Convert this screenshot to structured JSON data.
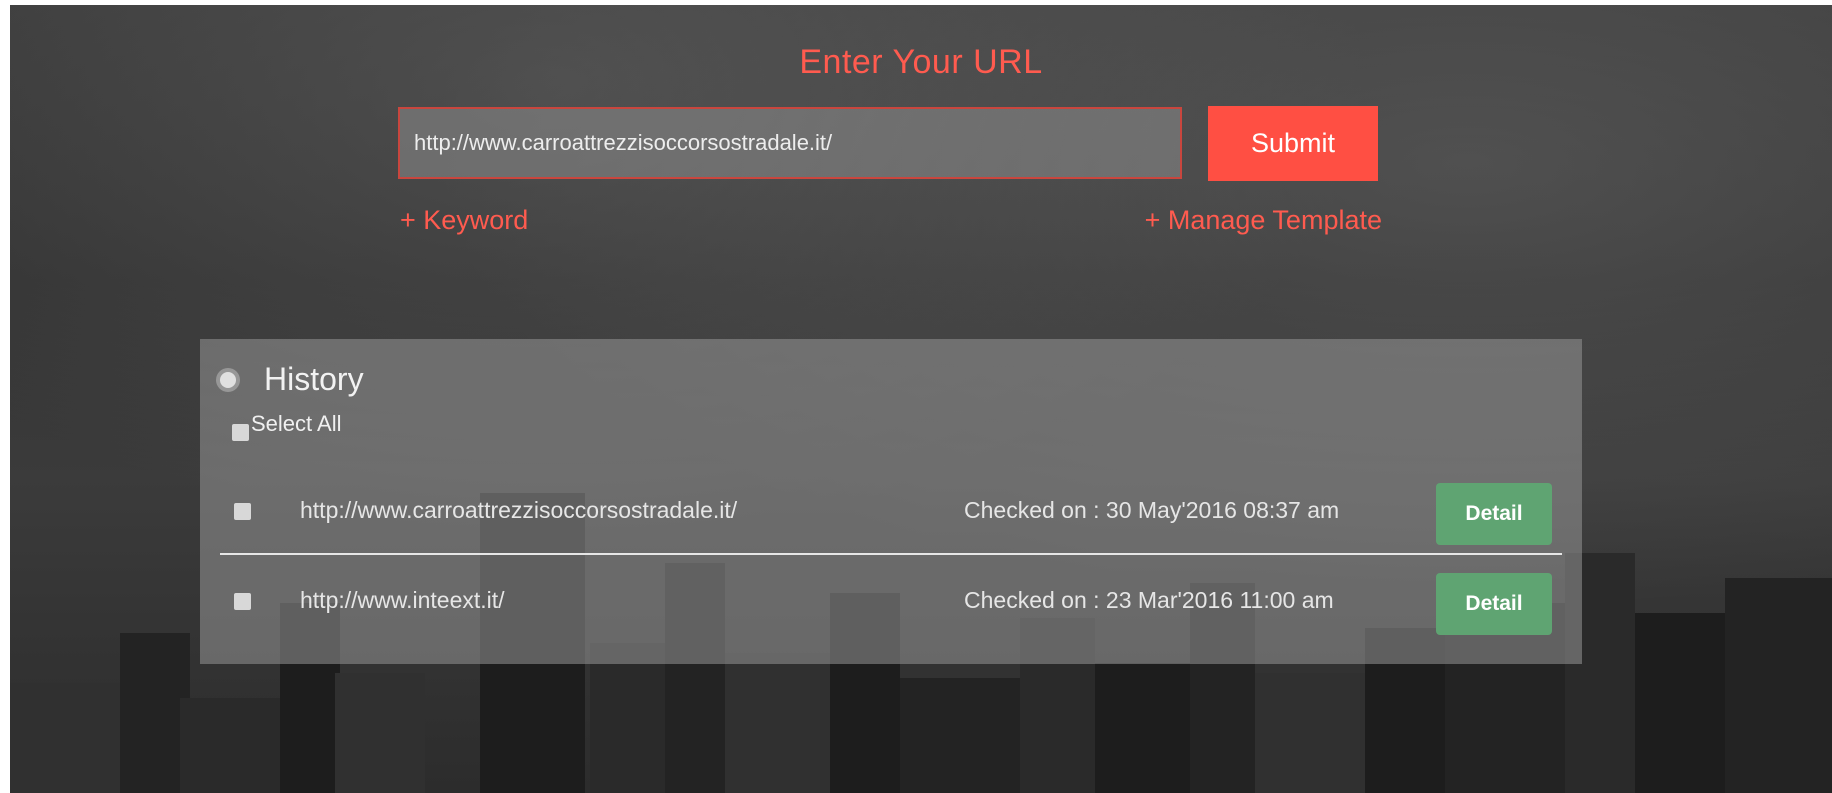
{
  "form": {
    "title": "Enter Your URL",
    "url_value": "http://www.carroattrezzisoccorsostradale.it/",
    "submit_label": "Submit",
    "keyword_link": "+ Keyword",
    "manage_template_link": "+ Manage Template"
  },
  "history": {
    "title": "History",
    "select_all_label": "Select All",
    "detail_label": "Detail",
    "rows": [
      {
        "url": "http://www.carroattrezzisoccorsostradale.it/",
        "checked_on": "Checked on : 30 May'2016 08:37 am"
      },
      {
        "url": "http://www.inteext.it/",
        "checked_on": "Checked on : 23 Mar'2016 11:00 am"
      }
    ]
  },
  "colors": {
    "accent": "#ff4f43",
    "detail_button": "#5fa472",
    "panel": "#969696"
  }
}
